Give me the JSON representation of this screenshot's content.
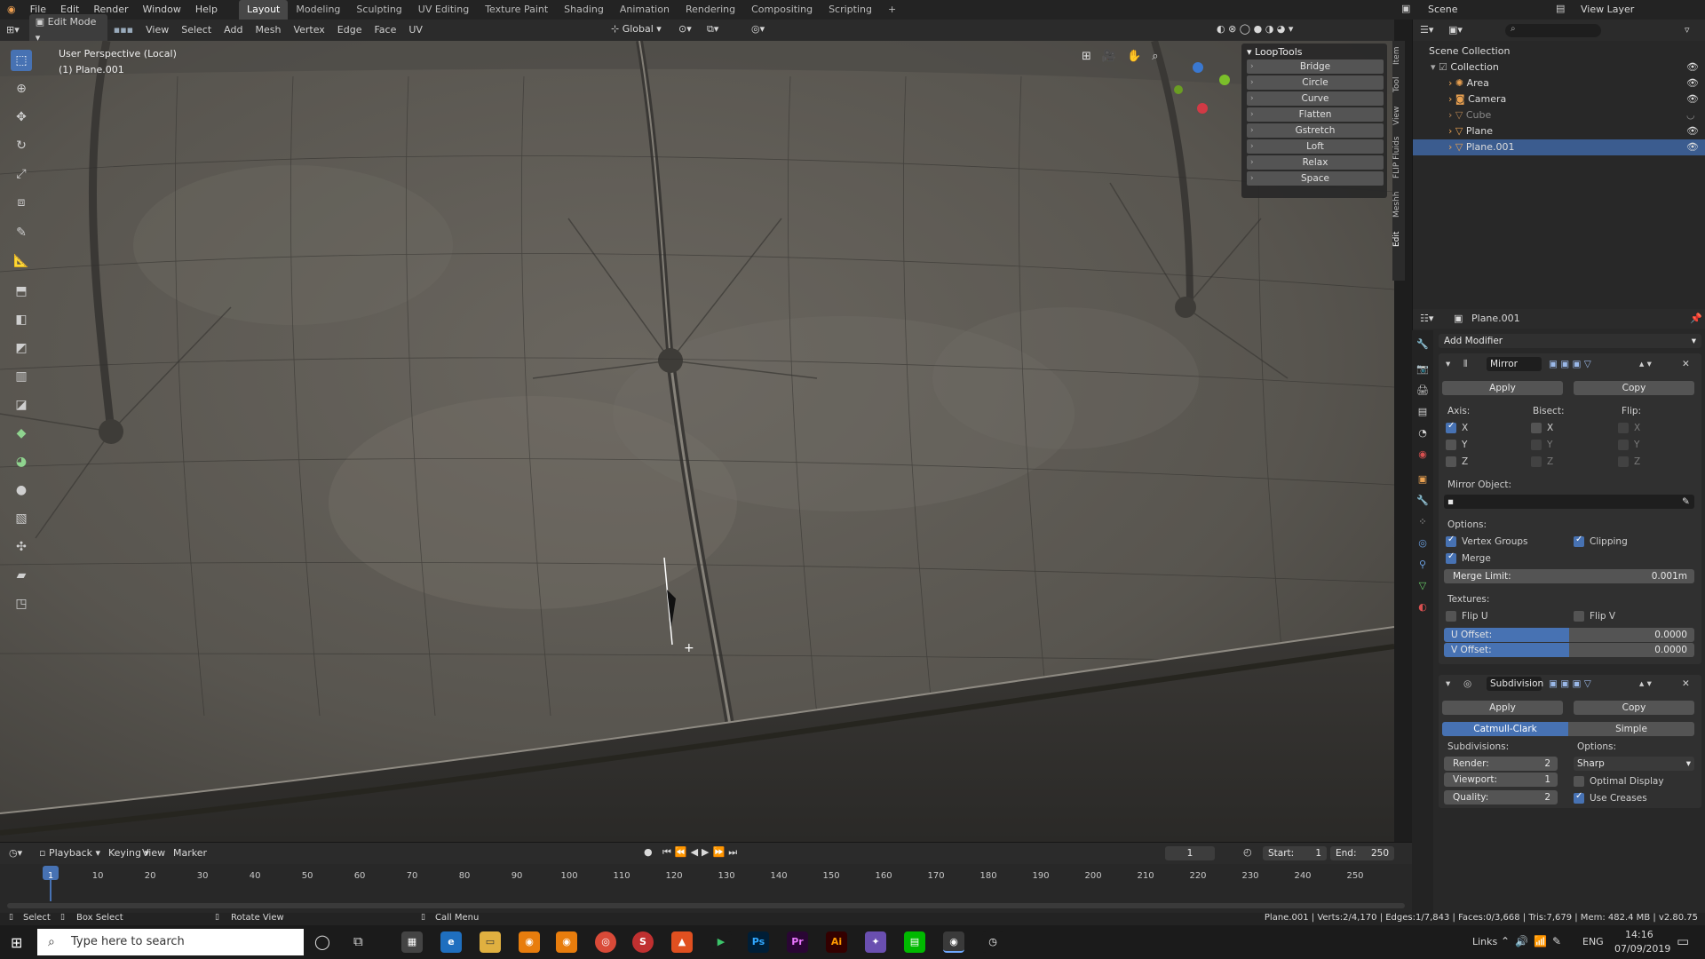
{
  "menus": {
    "file": "File",
    "edit": "Edit",
    "render": "Render",
    "window": "Window",
    "help": "Help"
  },
  "workspaces": [
    "Layout",
    "Modeling",
    "Sculpting",
    "UV Editing",
    "Texture Paint",
    "Shading",
    "Animation",
    "Rendering",
    "Compositing",
    "Scripting"
  ],
  "top_right": {
    "scene": "Scene",
    "view_layer": "View Layer"
  },
  "header": {
    "mode": "Edit Mode",
    "view": "View",
    "select": "Select",
    "add": "Add",
    "mesh": "Mesh",
    "vertex": "Vertex",
    "edge": "Edge",
    "face": "Face",
    "uv": "UV",
    "transform": "Global"
  },
  "viewport": {
    "perspective": "User Perspective (Local)",
    "object": "(1) Plane.001"
  },
  "looptools": {
    "title": "LoopTools",
    "items": [
      "Bridge",
      "Circle",
      "Curve",
      "Flatten",
      "Gstretch",
      "Loft",
      "Relax",
      "Space"
    ]
  },
  "side_tabs": [
    "Item",
    "Tool",
    "View",
    "FLIP Fluids",
    "Meshh",
    "Edit"
  ],
  "outliner": {
    "root": "Scene Collection",
    "collection": "Collection",
    "items": [
      "Area",
      "Camera",
      "Cube",
      "Plane",
      "Plane.001"
    ]
  },
  "properties": {
    "object": "Plane.001",
    "add_modifier": "Add Modifier",
    "mirror": {
      "name": "Mirror",
      "apply": "Apply",
      "copy": "Copy",
      "axis": "Axis:",
      "bisect": "Bisect:",
      "flip": "Flip:",
      "x": "X",
      "y": "Y",
      "z": "Z",
      "mirror_object": "Mirror Object:",
      "options": "Options:",
      "vertex_groups": "Vertex Groups",
      "clipping": "Clipping",
      "merge": "Merge",
      "merge_limit_label": "Merge Limit:",
      "merge_limit": "0.001m",
      "textures": "Textures:",
      "flip_u": "Flip U",
      "flip_v": "Flip V",
      "u_offset_label": "U Offset:",
      "u_offset": "0.0000",
      "v_offset_label": "V Offset:",
      "v_offset": "0.0000"
    },
    "subdivision": {
      "name": "Subdivision",
      "apply": "Apply",
      "copy": "Copy",
      "catmull": "Catmull-Clark",
      "simple": "Simple",
      "subdivisions": "Subdivisions:",
      "options": "Options:",
      "render_label": "Render:",
      "render": "2",
      "viewport_label": "Viewport:",
      "viewport": "1",
      "quality_label": "Quality:",
      "quality": "2",
      "sharp": "Sharp",
      "optimal_display": "Optimal Display",
      "use_creases": "Use Creases"
    }
  },
  "timeline": {
    "playback": "Playback",
    "keying": "Keying",
    "view": "View",
    "marker": "Marker",
    "current": "1",
    "start_label": "Start:",
    "start": "1",
    "end_label": "End:",
    "end": "250",
    "ticks": [
      "1",
      "10",
      "20",
      "30",
      "40",
      "50",
      "60",
      "70",
      "80",
      "90",
      "100",
      "110",
      "120",
      "130",
      "140",
      "150",
      "160",
      "170",
      "180",
      "190",
      "200",
      "210",
      "220",
      "230",
      "240",
      "250"
    ]
  },
  "status": {
    "select": "Select",
    "box_select": "Box Select",
    "rotate_view": "Rotate View",
    "call_menu": "Call Menu",
    "stats": "Plane.001 | Verts:2/4,170 | Edges:1/7,843 | Faces:0/3,668 | Tris:7,679 | Mem: 482.4 MB | v2.80.75"
  },
  "taskbar": {
    "search": "Type here to search",
    "links": "Links",
    "lang": "ENG",
    "time": "14:16",
    "date": "07/09/2019"
  }
}
